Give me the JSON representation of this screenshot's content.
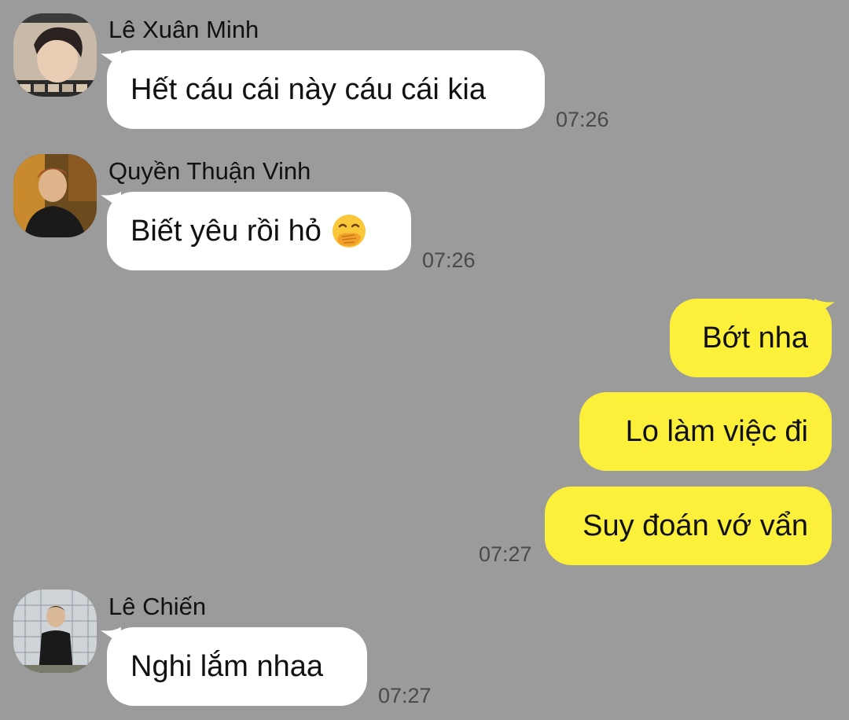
{
  "messages": [
    {
      "sender": "Lê Xuân Minh",
      "text": "Hết cáu cái này cáu cái kia",
      "time": "07:26",
      "avatar": "avatar-photo"
    },
    {
      "sender": "Quyền Thuận Vinh",
      "text": "Biết yêu rồi hỏ",
      "emoji": "face-with-hand-over-mouth-icon",
      "time": "07:26",
      "avatar": "avatar-photo"
    },
    {
      "outgoing": true,
      "texts": [
        "Bớt nha",
        "Lo làm việc đi",
        "Suy đoán vớ vẩn"
      ],
      "time": "07:27"
    },
    {
      "sender": "Lê Chiến",
      "text": "Nghi lắm nhaa",
      "time": "07:27",
      "avatar": "avatar-photo"
    }
  ],
  "colors": {
    "background": "#9b9b9b",
    "incoming_bubble": "#ffffff",
    "outgoing_bubble": "#fdf03a",
    "time_text": "#4a4a4a"
  }
}
